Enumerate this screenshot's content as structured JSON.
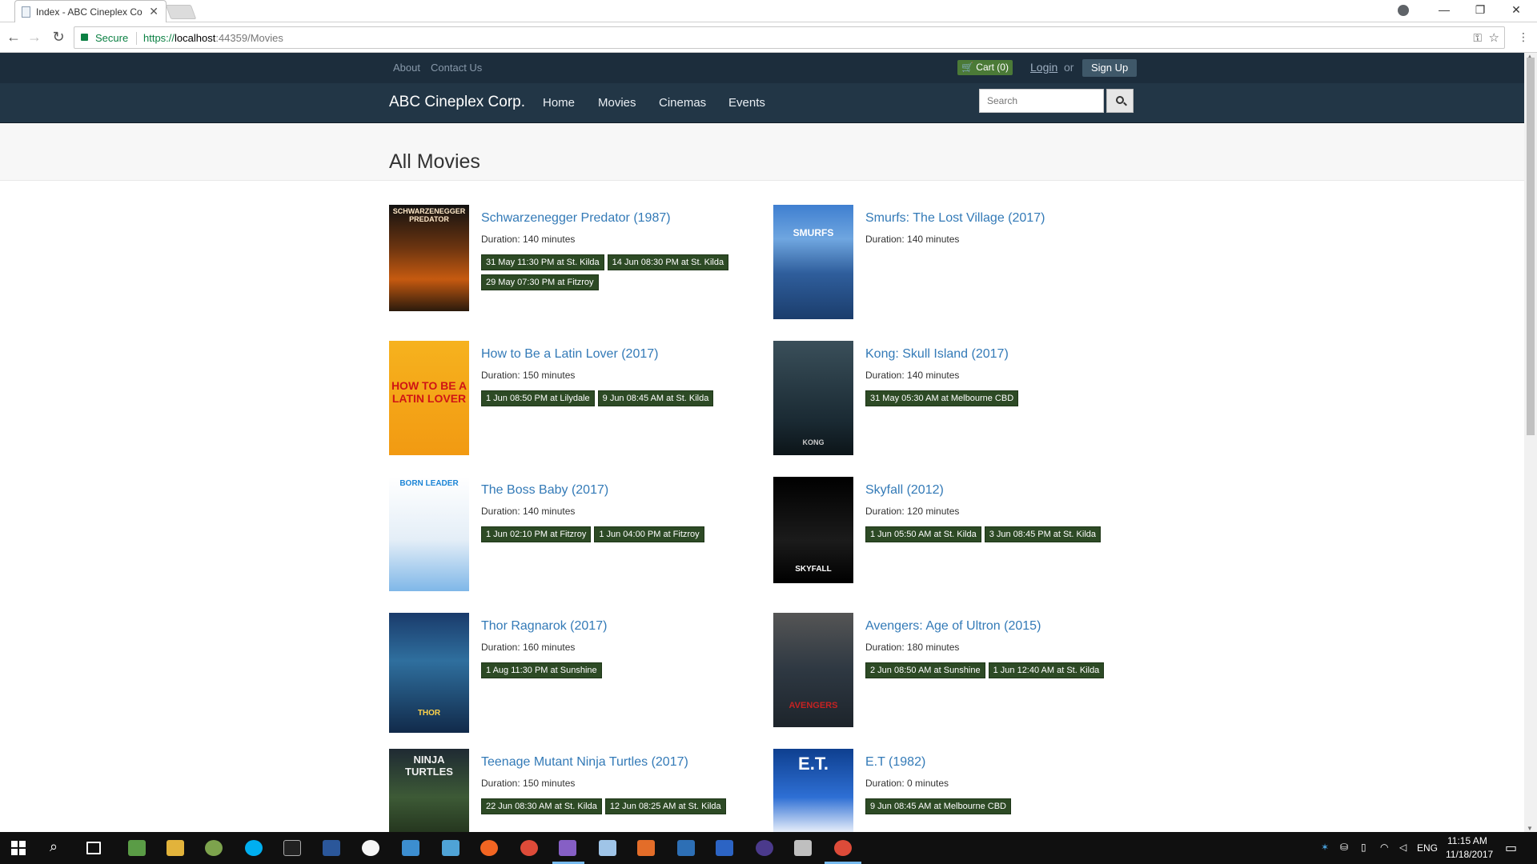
{
  "browser": {
    "tab_title": "Index - ABC Cineplex Co",
    "secure_label": "Secure",
    "url_prefix": "https://",
    "url_host": "localhost",
    "url_rest": ":44359/Movies",
    "icons": [
      "back-icon",
      "forward-icon",
      "reload-icon",
      "lock-icon",
      "key-icon",
      "star-icon",
      "menu-icon"
    ]
  },
  "topbar": {
    "about": "About",
    "contact": "Contact Us",
    "cart": "Cart (0)",
    "login": "Login",
    "or": "or",
    "signup": "Sign Up"
  },
  "nav": {
    "brand": "ABC Cineplex Corp.",
    "links": [
      "Home",
      "Movies",
      "Cinemas",
      "Events"
    ],
    "search_placeholder": "Search"
  },
  "page": {
    "title": "All Movies"
  },
  "movies": [
    {
      "title": "Schwarzenegger Predator (1987)",
      "duration": "Duration: 140 minutes",
      "poster_text": "SCHWARZENEGGER PREDATOR",
      "sessions": [
        "31 May 11:30 PM at St. Kilda",
        "14 Jun 08:30 PM at St. Kilda",
        "29 May 07:30 PM at Fitzroy"
      ]
    },
    {
      "title": "Smurfs: The Lost Village (2017)",
      "duration": "Duration: 140 minutes",
      "poster_text": "SMURFS",
      "sessions": []
    },
    {
      "title": "How to Be a Latin Lover (2017)",
      "duration": "Duration: 150 minutes",
      "poster_text": "HOW TO BE A LATIN LOVER",
      "sessions": [
        "1 Jun 08:50 PM at Lilydale",
        "9 Jun 08:45 AM at St. Kilda"
      ]
    },
    {
      "title": "Kong: Skull Island (2017)",
      "duration": "Duration: 140 minutes",
      "poster_text": "KONG",
      "sessions": [
        "31 May 05:30 AM at Melbourne CBD"
      ]
    },
    {
      "title": "The Boss Baby (2017)",
      "duration": "Duration: 140 minutes",
      "poster_text": "BORN LEADER",
      "sessions": [
        "1 Jun 02:10 PM at Fitzroy",
        "1 Jun 04:00 PM at Fitzroy"
      ]
    },
    {
      "title": "Skyfall (2012)",
      "duration": "Duration: 120 minutes",
      "poster_text": "SKYFALL",
      "sessions": [
        "1 Jun 05:50 AM at St. Kilda",
        "3 Jun 08:45 PM at St. Kilda"
      ]
    },
    {
      "title": "Thor Ragnarok (2017)",
      "duration": "Duration: 160 minutes",
      "poster_text": "THOR",
      "sessions": [
        "1 Aug 11:30 PM at Sunshine"
      ]
    },
    {
      "title": "Avengers: Age of Ultron (2015)",
      "duration": "Duration: 180 minutes",
      "poster_text": "AVENGERS",
      "sessions": [
        "2 Jun 08:50 AM at Sunshine",
        "1 Jun 12:40 AM at St. Kilda"
      ]
    },
    {
      "title": "Teenage Mutant Ninja Turtles (2017)",
      "duration": "Duration: 150 minutes",
      "poster_text": "NINJA TURTLES",
      "sessions": [
        "22 Jun 08:30 AM at St. Kilda",
        "12 Jun 08:25 AM at St. Kilda"
      ]
    },
    {
      "title": "E.T (1982)",
      "duration": "Duration: 0 minutes",
      "poster_text": "E.T.",
      "sessions": [
        "9 Jun 08:45 AM at Melbourne CBD"
      ]
    }
  ],
  "taskbar": {
    "language": "ENG",
    "time": "11:15 AM",
    "date": "11/18/2017"
  }
}
